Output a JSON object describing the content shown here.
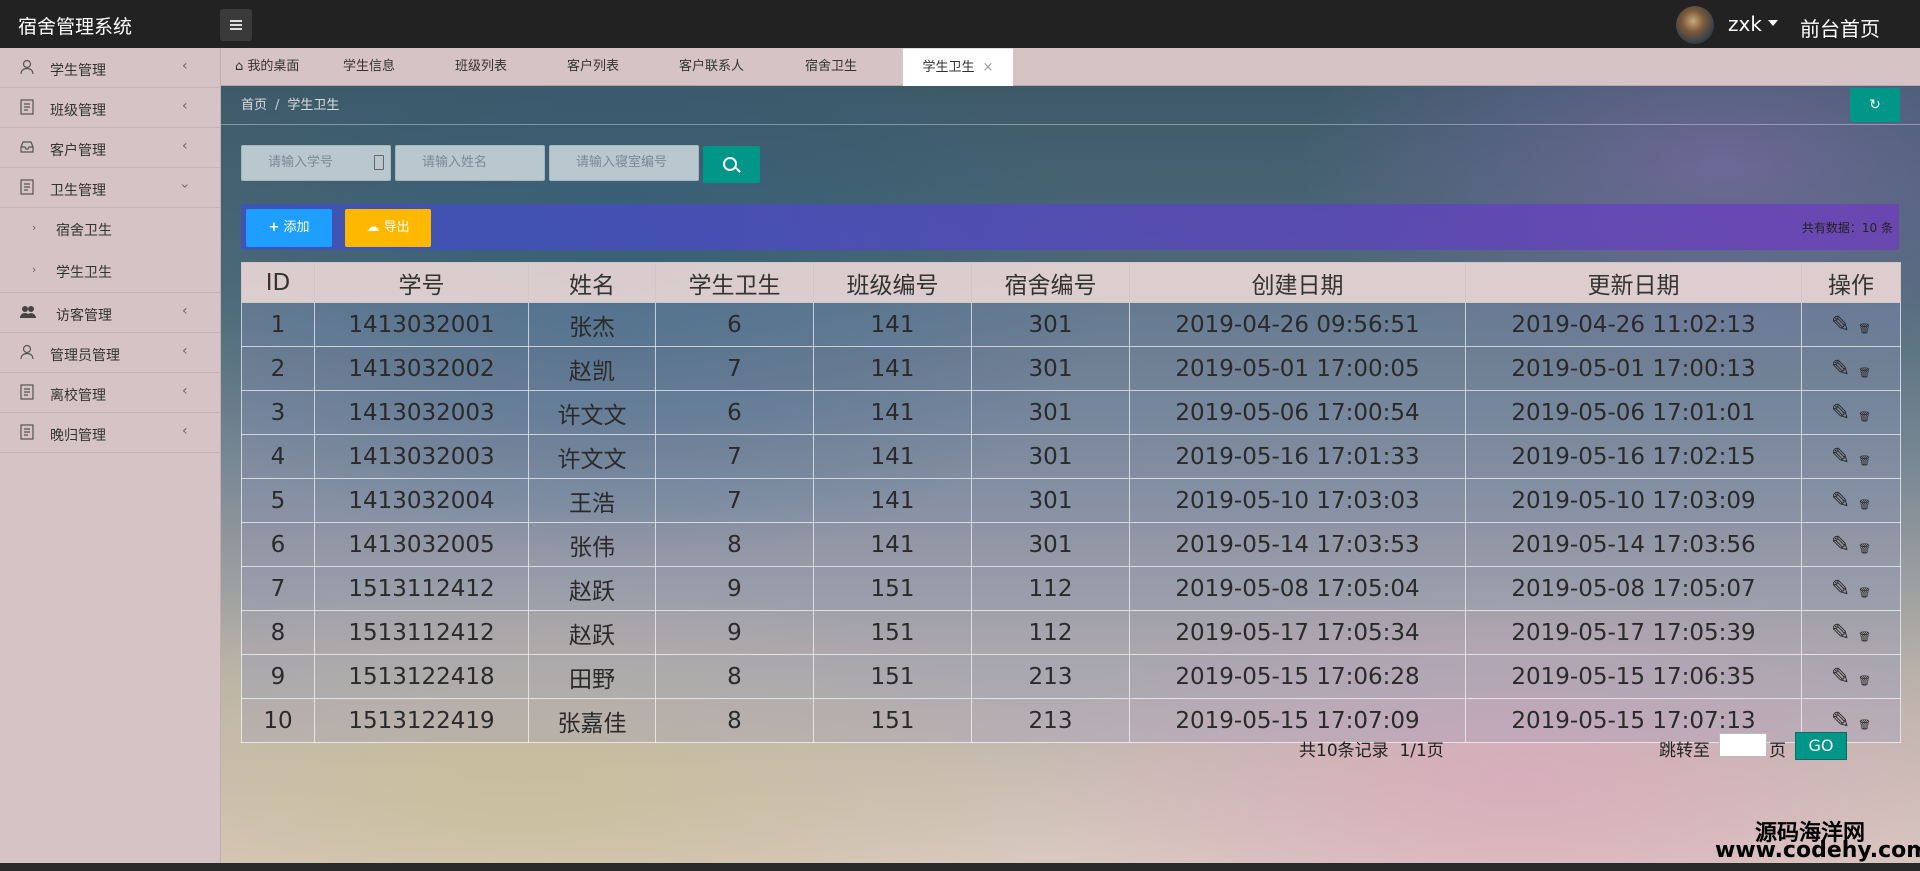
{
  "header": {
    "app_title": "宿舍管理系统",
    "username": "zxk",
    "front_link": "前台首页"
  },
  "sidebar": {
    "items": [
      {
        "label": "学生管理",
        "icon": "user-icon"
      },
      {
        "label": "班级管理",
        "icon": "document-icon"
      },
      {
        "label": "客户管理",
        "icon": "inbox-icon"
      },
      {
        "label": "卫生管理",
        "icon": "document-icon",
        "expanded": true,
        "children": [
          {
            "label": "宿舍卫生"
          },
          {
            "label": "学生卫生"
          }
        ]
      },
      {
        "label": "访客管理",
        "icon": "group-icon"
      },
      {
        "label": "管理员管理",
        "icon": "user-icon"
      },
      {
        "label": "离校管理",
        "icon": "document-icon"
      },
      {
        "label": "晚归管理",
        "icon": "document-icon"
      }
    ]
  },
  "tabs": [
    {
      "label": "我的桌面",
      "icon": "home-icon"
    },
    {
      "label": "学生信息"
    },
    {
      "label": "班级列表"
    },
    {
      "label": "客户列表"
    },
    {
      "label": "客户联系人"
    },
    {
      "label": "宿舍卫生"
    },
    {
      "label": "学生卫生",
      "active": true,
      "close": "×"
    }
  ],
  "breadcrumb": {
    "home": "首页",
    "sep": "/",
    "current": "学生卫生"
  },
  "refresh_icon": "refresh-icon",
  "search": {
    "student_no_placeholder": "请输入学号",
    "name_placeholder": "请输入姓名",
    "dorm_placeholder": "请输入寝室编号"
  },
  "toolbar": {
    "add_label": "添加",
    "export_label": "导出",
    "total_label": "共有数据：10 条"
  },
  "table": {
    "columns": [
      "ID",
      "学号",
      "姓名",
      "学生卫生",
      "班级编号",
      "宿舍编号",
      "创建日期",
      "更新日期",
      "操作"
    ],
    "rows": [
      [
        "1",
        "1413032001",
        "张杰",
        "6",
        "141",
        "301",
        "2019-04-26 09:56:51",
        "2019-04-26 11:02:13"
      ],
      [
        "2",
        "1413032002",
        "赵凯",
        "7",
        "141",
        "301",
        "2019-05-01 17:00:05",
        "2019-05-01 17:00:13"
      ],
      [
        "3",
        "1413032003",
        "许文文",
        "6",
        "141",
        "301",
        "2019-05-06 17:00:54",
        "2019-05-06 17:01:01"
      ],
      [
        "4",
        "1413032003",
        "许文文",
        "7",
        "141",
        "301",
        "2019-05-16 17:01:33",
        "2019-05-16 17:02:15"
      ],
      [
        "5",
        "1413032004",
        "王浩",
        "7",
        "141",
        "301",
        "2019-05-10 17:03:03",
        "2019-05-10 17:03:09"
      ],
      [
        "6",
        "1413032005",
        "张伟",
        "8",
        "141",
        "301",
        "2019-05-14 17:03:53",
        "2019-05-14 17:03:56"
      ],
      [
        "7",
        "1513112412",
        "赵跃",
        "9",
        "151",
        "112",
        "2019-05-08 17:05:04",
        "2019-05-08 17:05:07"
      ],
      [
        "8",
        "1513112412",
        "赵跃",
        "9",
        "151",
        "112",
        "2019-05-17 17:05:34",
        "2019-05-17 17:05:39"
      ],
      [
        "9",
        "1513122418",
        "田野",
        "8",
        "151",
        "213",
        "2019-05-15 17:06:28",
        "2019-05-15 17:06:35"
      ],
      [
        "10",
        "1513122419",
        "张嘉佳",
        "8",
        "151",
        "213",
        "2019-05-15 17:07:09",
        "2019-05-15 17:07:13"
      ]
    ]
  },
  "pager": {
    "summary": "共10条记录  1/1页",
    "jump_label": "跳转至",
    "page_unit": "页",
    "go_label": "GO"
  },
  "watermark": {
    "line1": "源码海洋网",
    "line2": "www.codehy.com"
  },
  "colors": {
    "accent": "#009688",
    "add": "#1e9fff",
    "export": "#ffb800"
  }
}
